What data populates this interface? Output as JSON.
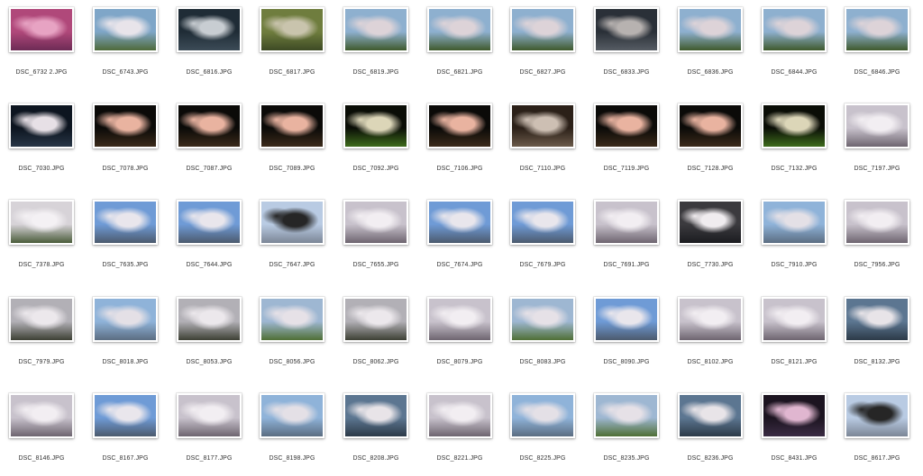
{
  "files": [
    {
      "name": "DSC_6732 2.JPG",
      "palette": "pink"
    },
    {
      "name": "DSC_6743.JPG",
      "palette": "skytree"
    },
    {
      "name": "DSC_6816.JPG",
      "palette": "water"
    },
    {
      "name": "DSC_6817.JPG",
      "palette": "moss"
    },
    {
      "name": "DSC_6819.JPG",
      "palette": "pond"
    },
    {
      "name": "DSC_6821.JPG",
      "palette": "pond"
    },
    {
      "name": "DSC_6827.JPG",
      "palette": "pond"
    },
    {
      "name": "DSC_6833.JPG",
      "palette": "petals"
    },
    {
      "name": "DSC_6836.JPG",
      "palette": "pond"
    },
    {
      "name": "DSC_6844.JPG",
      "palette": "pond"
    },
    {
      "name": "DSC_6846.JPG",
      "palette": "pond"
    },
    {
      "name": "DSC_7030.JPG",
      "palette": "nightbranch"
    },
    {
      "name": "DSC_7078.JPG",
      "palette": "night"
    },
    {
      "name": "DSC_7087.JPG",
      "palette": "night"
    },
    {
      "name": "DSC_7089.JPG",
      "palette": "night"
    },
    {
      "name": "DSC_7092.JPG",
      "palette": "nightgreen"
    },
    {
      "name": "DSC_7106.JPG",
      "palette": "night"
    },
    {
      "name": "DSC_7110.JPG",
      "palette": "nightfull"
    },
    {
      "name": "DSC_7119.JPG",
      "palette": "night"
    },
    {
      "name": "DSC_7128.JPG",
      "palette": "night"
    },
    {
      "name": "DSC_7132.JPG",
      "palette": "nightgreen"
    },
    {
      "name": "DSC_7197.JPG",
      "palette": "blossom"
    },
    {
      "name": "DSC_7378.JPG",
      "palette": "building"
    },
    {
      "name": "DSC_7635.JPG",
      "palette": "blue"
    },
    {
      "name": "DSC_7644.JPG",
      "palette": "blue"
    },
    {
      "name": "DSC_7647.JPG",
      "palette": "branches"
    },
    {
      "name": "DSC_7655.JPG",
      "palette": "blossom"
    },
    {
      "name": "DSC_7674.JPG",
      "palette": "blue"
    },
    {
      "name": "DSC_7679.JPG",
      "palette": "blue"
    },
    {
      "name": "DSC_7691.JPG",
      "palette": "blossom"
    },
    {
      "name": "DSC_7730.JPG",
      "palette": "blossomdark"
    },
    {
      "name": "DSC_7910.JPG",
      "palette": "skyline"
    },
    {
      "name": "DSC_7956.JPG",
      "palette": "blossom"
    },
    {
      "name": "DSC_7979.JPG",
      "palette": "path"
    },
    {
      "name": "DSC_8018.JPG",
      "palette": "skyline"
    },
    {
      "name": "DSC_8053.JPG",
      "palette": "path"
    },
    {
      "name": "DSC_8056.JPG",
      "palette": "park"
    },
    {
      "name": "DSC_8062.JPG",
      "palette": "path"
    },
    {
      "name": "DSC_8079.JPG",
      "palette": "blossom"
    },
    {
      "name": "DSC_8083.JPG",
      "palette": "park"
    },
    {
      "name": "DSC_8090.JPG",
      "palette": "blue"
    },
    {
      "name": "DSC_8102.JPG",
      "palette": "blossom"
    },
    {
      "name": "DSC_8121.JPG",
      "palette": "blossom"
    },
    {
      "name": "DSC_8132.JPG",
      "palette": "river"
    },
    {
      "name": "DSC_8146.JPG",
      "palette": "blossom"
    },
    {
      "name": "DSC_8167.JPG",
      "palette": "blue"
    },
    {
      "name": "DSC_8177.JPG",
      "palette": "blossom"
    },
    {
      "name": "DSC_8198.JPG",
      "palette": "skyline"
    },
    {
      "name": "DSC_8208.JPG",
      "palette": "river"
    },
    {
      "name": "DSC_8221.JPG",
      "palette": "blossom"
    },
    {
      "name": "DSC_8225.JPG",
      "palette": "skyline"
    },
    {
      "name": "DSC_8235.JPG",
      "palette": "park"
    },
    {
      "name": "DSC_8236.JPG",
      "palette": "river"
    },
    {
      "name": "DSC_8431.JPG",
      "palette": "nightpink"
    },
    {
      "name": "DSC_8617.JPG",
      "palette": "branches"
    }
  ],
  "palettes": {
    "pink": [
      "#b0487a",
      "#e7a3c3",
      "#6d2b55"
    ],
    "skytree": [
      "#7fa6c8",
      "#e8e4ea",
      "#4f6a3a"
    ],
    "water": [
      "#1f2c36",
      "#c8cdd2",
      "#3c4b57"
    ],
    "moss": [
      "#6f7d3e",
      "#c9c4ad",
      "#3d4a24"
    ],
    "pond": [
      "#8eb0cf",
      "#ddd3d8",
      "#3f5a2c"
    ],
    "petals": [
      "#2a3038",
      "#b7b2b0",
      "#565c63"
    ],
    "nightbranch": [
      "#0d1520",
      "#e7e0e6",
      "#283646"
    ],
    "night": [
      "#0b0a08",
      "#e9b3a0",
      "#3b2a1a"
    ],
    "nightgreen": [
      "#0a0d06",
      "#dcd6b8",
      "#3e6b1c"
    ],
    "nightfull": [
      "#2b2018",
      "#cdbfb3",
      "#6b5a4a"
    ],
    "blossom": [
      "#c8c2cc",
      "#f2eef2",
      "#6e6570"
    ],
    "building": [
      "#d7d3d8",
      "#f4f1f4",
      "#4a5c3a"
    ],
    "blue": [
      "#6f9bd6",
      "#e9e6ec",
      "#4c5a6e"
    ],
    "branches": [
      "#b9cbe3",
      "#262626",
      "#7b8696"
    ],
    "blossomdark": [
      "#3b3a3e",
      "#f0ecef",
      "#1b1c20"
    ],
    "skyline": [
      "#8fb3d9",
      "#e4e0e6",
      "#5b6d82"
    ],
    "path": [
      "#b2b0b6",
      "#ece8ec",
      "#3d4034"
    ],
    "park": [
      "#9eb7d2",
      "#e6e1e7",
      "#4f6f35"
    ],
    "river": [
      "#5c7691",
      "#e8e4e8",
      "#2c3a48"
    ],
    "nightpink": [
      "#1c1420",
      "#e0b6d0",
      "#3b2c44"
    ]
  }
}
